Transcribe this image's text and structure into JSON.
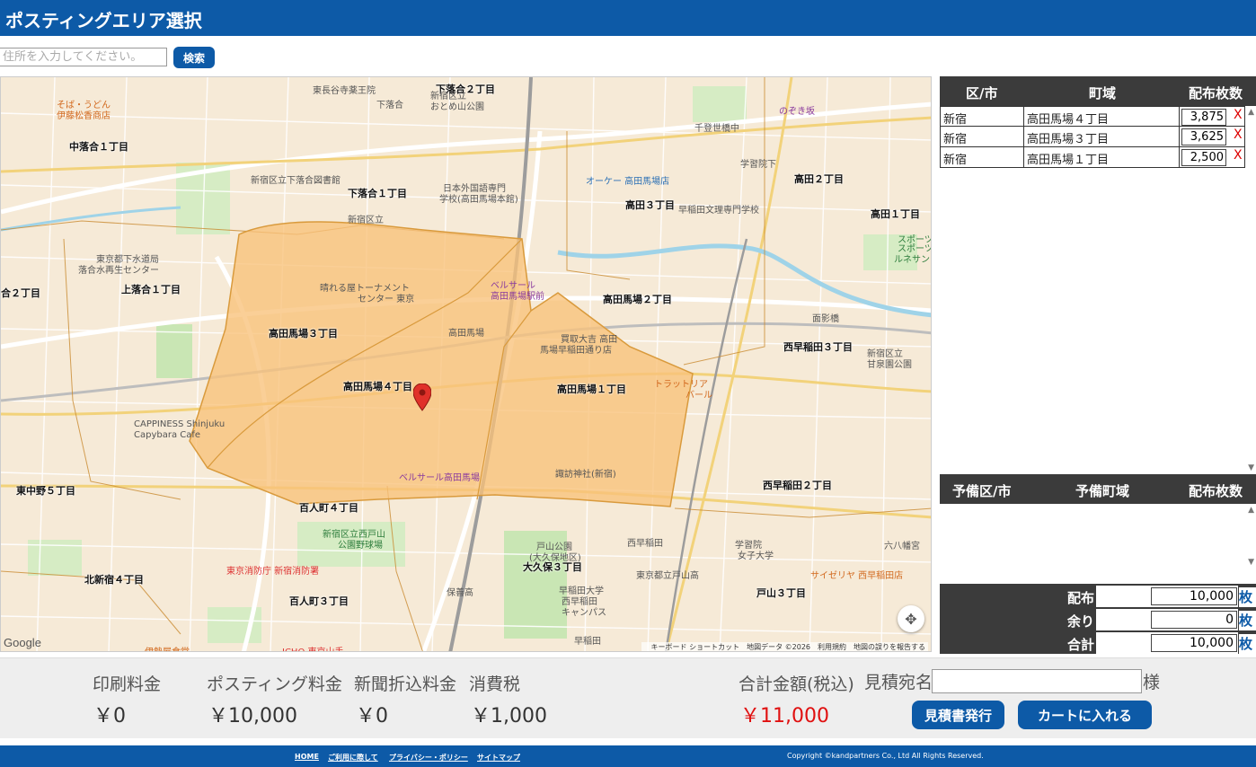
{
  "header": {
    "title": "ポスティングエリア選択"
  },
  "search": {
    "placeholder": "住所を入力してください。",
    "button_label": "検索"
  },
  "map": {
    "area_labels": [
      {
        "text": "下落合２丁目"
      },
      {
        "text": "中落合１丁目"
      },
      {
        "text": "下落合１丁目"
      },
      {
        "text": "高田３丁目"
      },
      {
        "text": "高田２丁目"
      },
      {
        "text": "高田１丁目"
      },
      {
        "text": "上落合１丁目"
      },
      {
        "text": "合２丁目"
      },
      {
        "text": "高田馬場２丁目"
      },
      {
        "text": "高田馬場３丁目"
      },
      {
        "text": "西早稲田３丁目"
      },
      {
        "text": "高田馬場４丁目"
      },
      {
        "text": "高田馬場１丁目"
      },
      {
        "text": "東中野５丁目"
      },
      {
        "text": "百人町４丁目"
      },
      {
        "text": "西早稲田２丁目"
      },
      {
        "text": "大久保３丁目"
      },
      {
        "text": "北新宿４丁目"
      },
      {
        "text": "百人町３丁目"
      },
      {
        "text": "戸山３丁目"
      }
    ],
    "pois": [
      {
        "text": "東長谷寺薬王院"
      },
      {
        "text": "下落合"
      },
      {
        "text": "新宿区立"
      },
      {
        "text": "おとめ山公園"
      },
      {
        "text": "そば・うどん"
      },
      {
        "text": "伊藤松香商店"
      },
      {
        "text": "新宿区立下落合図書館"
      },
      {
        "text": "日本外国語専門"
      },
      {
        "text": "学校(高田馬場本館)"
      },
      {
        "text": "オーケー 高田馬場店"
      },
      {
        "text": "早稲田文理専門学校"
      },
      {
        "text": "千登世橋中"
      },
      {
        "text": "学習院下"
      },
      {
        "text": "のぞき坂"
      },
      {
        "text": "東京都下水道局"
      },
      {
        "text": "落合水再生センター"
      },
      {
        "text": "新宿区立"
      },
      {
        "text": "高田馬場"
      },
      {
        "text": "晴れる屋トーナメント"
      },
      {
        "text": "センター 東京"
      },
      {
        "text": "ベルサール"
      },
      {
        "text": "高田馬場駅前"
      },
      {
        "text": "面影橋"
      },
      {
        "text": "新宿区立"
      },
      {
        "text": "甘泉園公園"
      },
      {
        "text": "スポーツ"
      },
      {
        "text": "ルネサン"
      },
      {
        "text": "買取大吉 高田"
      },
      {
        "text": "馬場早稲田通り店"
      },
      {
        "text": "トラットリア"
      },
      {
        "text": "バール"
      },
      {
        "text": "CAPPINESS Shinjuku"
      },
      {
        "text": "Capybara Cafe"
      },
      {
        "text": "ベルサール高田馬場"
      },
      {
        "text": "諏訪神社(新宿)"
      },
      {
        "text": "西早稲田"
      },
      {
        "text": "新宿区立西戸山"
      },
      {
        "text": "公園野球場"
      },
      {
        "text": "戸山公園"
      },
      {
        "text": "(大久保地区)"
      },
      {
        "text": "学習院"
      },
      {
        "text": "女子大学"
      },
      {
        "text": "東京消防庁 新宿消防署"
      },
      {
        "text": "保善高"
      },
      {
        "text": "早稲田大学"
      },
      {
        "text": "西早稲田"
      },
      {
        "text": "キャンパス"
      },
      {
        "text": "東京都立戸山高"
      },
      {
        "text": "サイゼリヤ 西早稲田店"
      },
      {
        "text": "六八幡宮"
      },
      {
        "text": "伊勢屋食堂"
      },
      {
        "text": "JCHO 東京山手"
      },
      {
        "text": "早稲田"
      },
      {
        "text": "スポーツ"
      },
      {
        "text": "学習院大学"
      },
      {
        "text": "西早稲田"
      }
    ],
    "google": "Google",
    "attribution": [
      "キーボード ショートカット",
      "地図データ ©2026",
      "利用規約",
      "地図の誤りを報告する"
    ]
  },
  "area_table": {
    "headers": [
      "区/市",
      "町域",
      "配布枚数"
    ],
    "rows": [
      {
        "ward": "新宿",
        "town": "高田馬場４丁目",
        "count": "3,875",
        "remove": "X"
      },
      {
        "ward": "新宿",
        "town": "高田馬場３丁目",
        "count": "3,625",
        "remove": "X"
      },
      {
        "ward": "新宿",
        "town": "高田馬場１丁目",
        "count": "2,500",
        "remove": "X"
      }
    ]
  },
  "spare_table": {
    "headers": [
      "予備区/市",
      "予備町域",
      "配布枚数"
    ]
  },
  "totals": {
    "rows": [
      {
        "label": "配布",
        "value": "10,000",
        "unit": "枚"
      },
      {
        "label": "余り",
        "value": "0",
        "unit": "枚"
      },
      {
        "label": "合計",
        "value": "10,000",
        "unit": "枚"
      }
    ]
  },
  "fees": {
    "print": {
      "label": "印刷料金",
      "value": "￥0"
    },
    "posting": {
      "label": "ポスティング料金",
      "value": "￥10,000"
    },
    "newspaper": {
      "label": "新聞折込料金",
      "value": "￥0"
    },
    "tax": {
      "label": "消費税",
      "value": "￥1,000"
    },
    "total": {
      "label": "合計金額(税込)",
      "value": "￥11,000"
    }
  },
  "estimate": {
    "label": "見積宛名",
    "suffix": "様",
    "issue_button": "見積書発行",
    "cart_button": "カートに入れる"
  },
  "footer": {
    "links": [
      "HOME",
      "ご利用に際して",
      "プライバシー・ポリシー",
      "サイトマップ"
    ],
    "copyright": "Copyright ©kandpartners Co., Ltd All Rights Reserved."
  },
  "colors": {
    "brand_blue": "#0d5aa7",
    "selection_fill": "#f9c17a",
    "selection_stroke": "#d99a3c",
    "price_red": "#e01010",
    "remove_red": "#dd0000"
  },
  "icons": [
    "map-pin-icon",
    "scroll-up-icon",
    "scroll-down-icon",
    "map-pan-icon"
  ]
}
